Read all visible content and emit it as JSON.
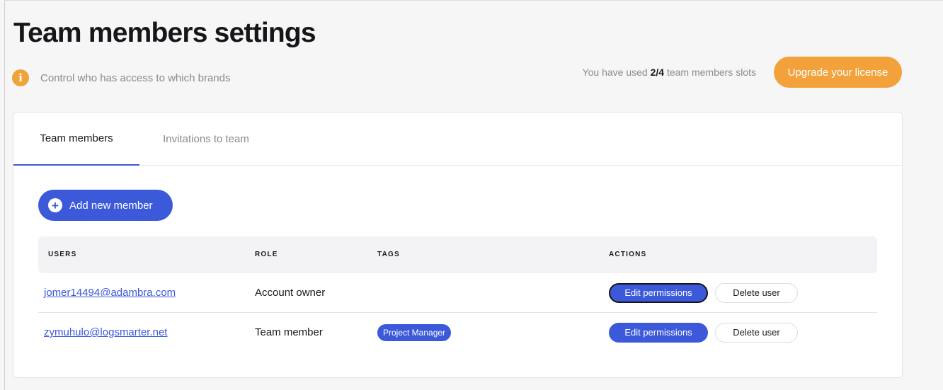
{
  "header": {
    "title": "Team members settings",
    "info_text": "Control who has access to which brands",
    "slots_prefix": "You have used ",
    "slots_count": "2/4",
    "slots_suffix": " team members slots",
    "upgrade_label": "Upgrade your license",
    "info_icon": "info-icon",
    "accent_color": "#f3a23b"
  },
  "tabs": [
    {
      "label": "Team members",
      "active": true
    },
    {
      "label": "Invitations to team",
      "active": false
    }
  ],
  "add_member_label": "Add new member",
  "table": {
    "headers": [
      "USERS",
      "ROLE",
      "TAGS",
      "ACTIONS"
    ],
    "rows": [
      {
        "user": "jomer14494@adambra.com",
        "role": "Account owner",
        "tag": "",
        "edit_label": "Edit permissions",
        "delete_label": "Delete user"
      },
      {
        "user": "zymuhulo@logsmarter.net",
        "role": "Team member",
        "tag": "Project Manager",
        "edit_label": "Edit permissions",
        "delete_label": "Delete user"
      }
    ]
  },
  "colors": {
    "primary": "#3b59d9",
    "warning": "#f0a23b",
    "background": "#f6f6f7"
  }
}
